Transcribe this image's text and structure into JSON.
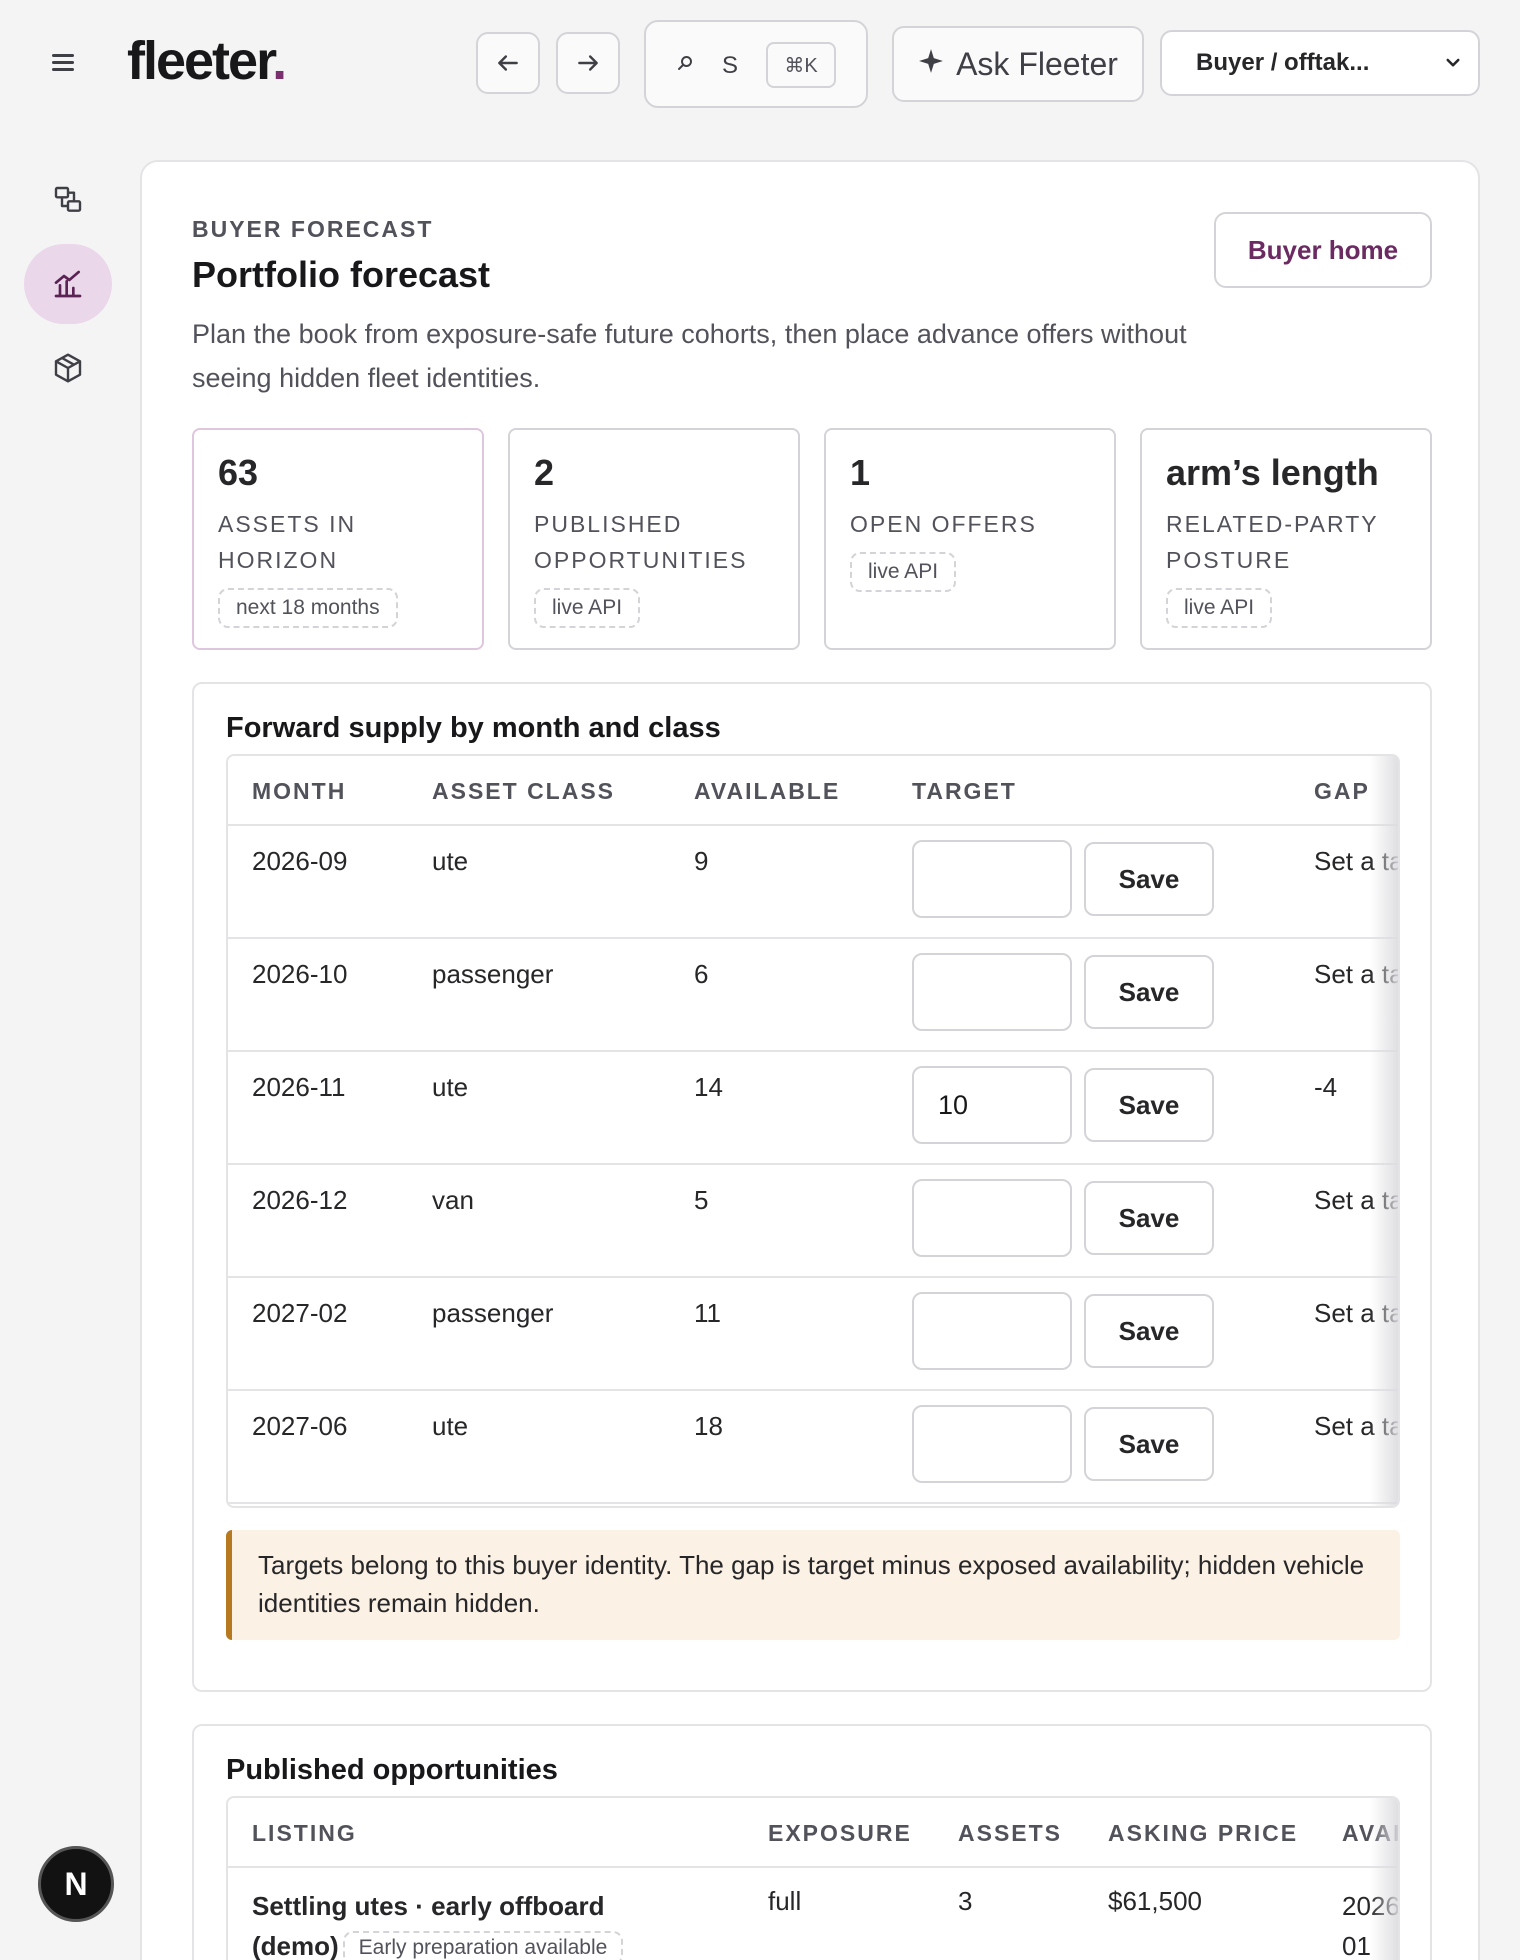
{
  "app": {
    "brand": "fleeter",
    "brand_dot": ".",
    "search_letter": "S",
    "search_shortcut": "⌘K",
    "ask_label": "Ask Fleeter",
    "role_selected": "Buyer / offtak..."
  },
  "header": {
    "eyebrow": "BUYER FORECAST",
    "title": "Portfolio forecast",
    "description": "Plan the book from exposure-safe future cohorts, then place advance offers without seeing hidden fleet identities.",
    "buyer_home_label": "Buyer home"
  },
  "stats": [
    {
      "value": "63",
      "label": "ASSETS IN HORIZON",
      "pill": "next 18 months"
    },
    {
      "value": "2",
      "label": "PUBLISHED OPPORTUNITIES",
      "pill": "live API"
    },
    {
      "value": "1",
      "label": "OPEN OFFERS",
      "pill": "live API"
    },
    {
      "value": "arm’s length",
      "label": "RELATED-PARTY POSTURE",
      "pill": "live API"
    }
  ],
  "supply": {
    "title": "Forward supply by month and class",
    "columns": {
      "month": "MONTH",
      "asset_class": "ASSET CLASS",
      "available": "AVAILABLE",
      "target": "TARGET",
      "gap": "GAP"
    },
    "save_label": "Save",
    "rows": [
      {
        "month": "2026-09",
        "asset_class": "ute",
        "available": "9",
        "target": "",
        "gap": "Set a ta"
      },
      {
        "month": "2026-10",
        "asset_class": "passenger",
        "available": "6",
        "target": "",
        "gap": "Set a ta"
      },
      {
        "month": "2026-11",
        "asset_class": "ute",
        "available": "14",
        "target": "10",
        "gap": "-4"
      },
      {
        "month": "2026-12",
        "asset_class": "van",
        "available": "5",
        "target": "",
        "gap": "Set a ta"
      },
      {
        "month": "2027-02",
        "asset_class": "passenger",
        "available": "11",
        "target": "",
        "gap": "Set a ta"
      },
      {
        "month": "2027-06",
        "asset_class": "ute",
        "available": "18",
        "target": "",
        "gap": "Set a ta"
      }
    ],
    "note": "Targets belong to this buyer identity. The gap is target minus exposed availability; hidden vehicle identities remain hidden."
  },
  "opportunities": {
    "title": "Published opportunities",
    "columns": {
      "listing": "LISTING",
      "exposure": "EXPOSURE",
      "assets": "ASSETS",
      "asking_price": "ASKING PRICE",
      "available": "AVAI"
    },
    "rows": [
      {
        "listing": "Settling utes · early offboard (demo)",
        "tag": "Early preparation available",
        "exposure": "full",
        "assets": "3",
        "asking_price": "$61,500",
        "available_line1": "2026",
        "available_line2": "01"
      }
    ]
  },
  "badge": {
    "letter": "N"
  }
}
